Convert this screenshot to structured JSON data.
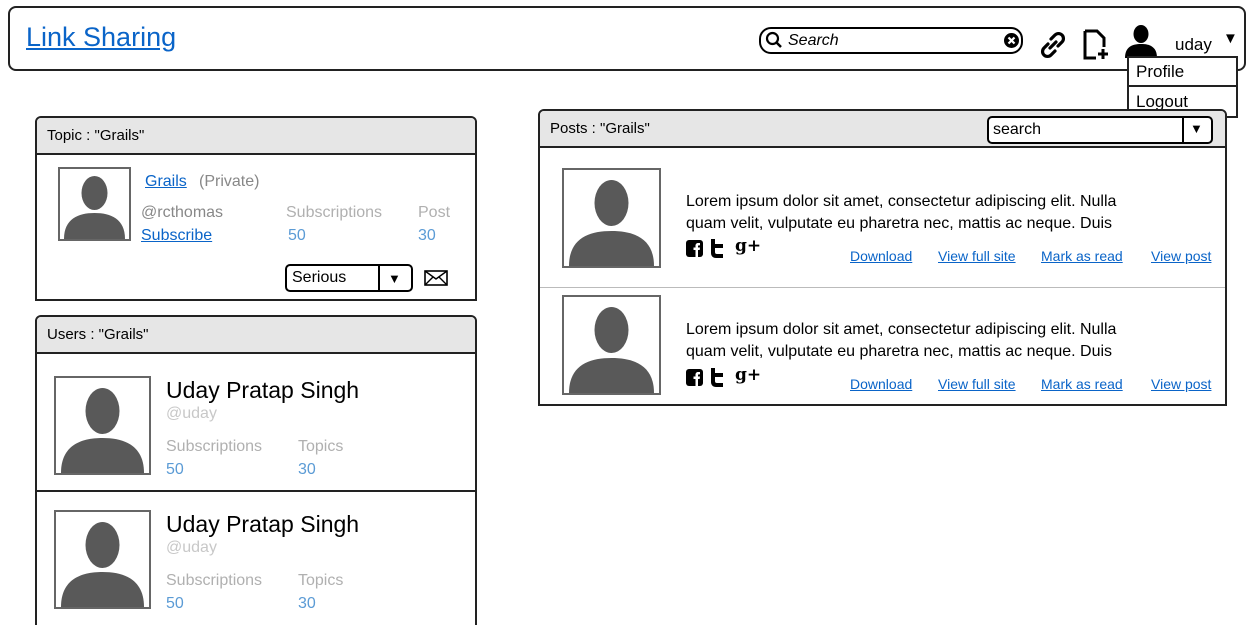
{
  "header": {
    "title": "Link Sharing",
    "search_placeholder": "Search",
    "username": "uday",
    "menu": [
      "Profile",
      "Logout"
    ]
  },
  "topic_panel": {
    "heading": "Topic : \"Grails\"",
    "topic_name": "Grails",
    "visibility": "(Private)",
    "owner": "@rcthomas",
    "subscribe_label": "Subscribe",
    "subscriptions_label": "Subscriptions",
    "subscriptions_value": "50",
    "post_label": "Post",
    "post_value": "30",
    "seriousness": "Serious"
  },
  "users_panel": {
    "heading": "Users : \"Grails\"",
    "users": [
      {
        "name": "Uday Pratap Singh",
        "handle": "@uday",
        "subscriptions_label": "Subscriptions",
        "subscriptions": "50",
        "topics_label": "Topics",
        "topics": "30"
      },
      {
        "name": "Uday Pratap Singh",
        "handle": "@uday",
        "subscriptions_label": "Subscriptions",
        "subscriptions": "50",
        "topics_label": "Topics",
        "topics": "30"
      }
    ]
  },
  "posts_panel": {
    "heading": "Posts : \"Grails\"",
    "search_placeholder": "search",
    "posts": [
      {
        "line1": "Lorem ipsum dolor sit amet, consectetur adipiscing elit. Nulla",
        "line2": "quam velit, vulputate eu pharetra nec, mattis ac neque. Duis",
        "actions": [
          "Download",
          "View full site",
          "Mark as read",
          "View post"
        ]
      },
      {
        "line1": "Lorem ipsum dolor sit amet, consectetur adipiscing elit. Nulla",
        "line2": "quam velit, vulputate eu pharetra nec, mattis ac neque. Duis",
        "actions": [
          "Download",
          "View full site",
          "Mark as read",
          "View post"
        ]
      }
    ]
  },
  "icons": [
    "search-icon",
    "clear-icon",
    "link-icon",
    "new-document-icon",
    "user-icon",
    "dropdown-caret-icon",
    "mail-icon",
    "facebook-icon",
    "twitter-icon",
    "google-plus-icon"
  ],
  "glyphs": {
    "caret": "▼",
    "google_plus": "g+"
  }
}
